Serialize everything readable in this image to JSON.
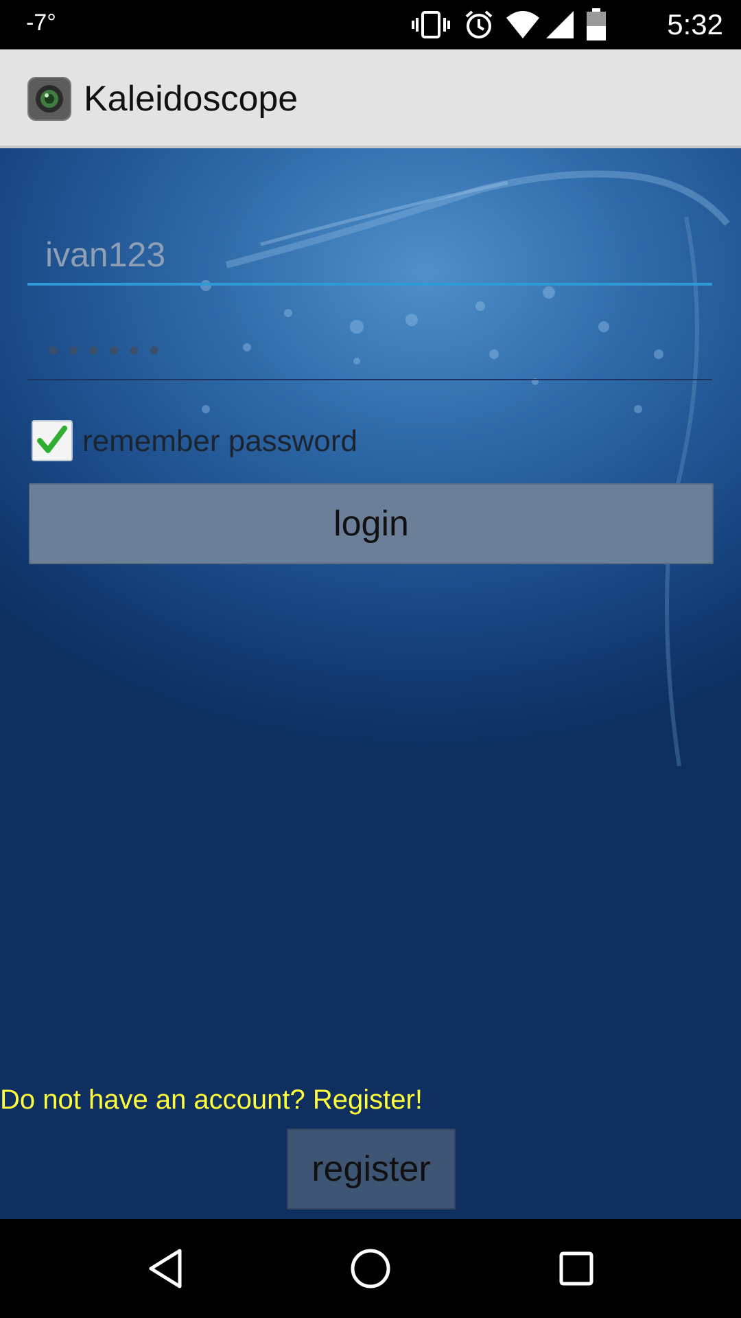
{
  "status_bar": {
    "temperature": "-7°",
    "time": "5:32",
    "icons": [
      "vibrate-icon",
      "alarm-icon",
      "wifi-icon",
      "signal-icon",
      "battery-icon"
    ]
  },
  "app_bar": {
    "title": "Kaleidoscope",
    "logo_icon": "camera-lens-icon"
  },
  "login_form": {
    "username_value": "ivan123",
    "password_mask": "••••••",
    "remember_label": "remember password",
    "remember_checked": true,
    "login_label": "login"
  },
  "register": {
    "hint": "Do not have an account? Register!",
    "button_label": "register"
  },
  "colors": {
    "hint_yellow": "#ffff3c",
    "focus_underline": "#2e9bd6",
    "check_green": "#2fae2f"
  },
  "nav_bar": {
    "icons": [
      "back-icon",
      "home-icon",
      "recents-icon"
    ]
  }
}
